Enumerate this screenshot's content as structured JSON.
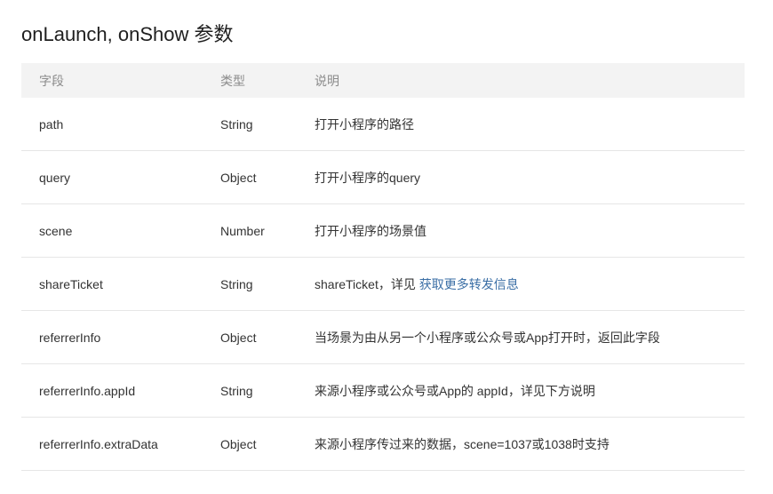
{
  "title": "onLaunch, onShow 参数",
  "table": {
    "headers": {
      "field": "字段",
      "type": "类型",
      "desc": "说明"
    },
    "rows": [
      {
        "field": "path",
        "type": "String",
        "desc": "打开小程序的路径",
        "desc_link": ""
      },
      {
        "field": "query",
        "type": "Object",
        "desc": "打开小程序的query",
        "desc_link": ""
      },
      {
        "field": "scene",
        "type": "Number",
        "desc": "打开小程序的场景值",
        "desc_link": ""
      },
      {
        "field": "shareTicket",
        "type": "String",
        "desc": "shareTicket，详见 ",
        "desc_link": "获取更多转发信息"
      },
      {
        "field": "referrerInfo",
        "type": "Object",
        "desc": "当场景为由从另一个小程序或公众号或App打开时，返回此字段",
        "desc_link": ""
      },
      {
        "field": "referrerInfo.appId",
        "type": "String",
        "desc": "来源小程序或公众号或App的 appId，详见下方说明",
        "desc_link": ""
      },
      {
        "field": "referrerInfo.extraData",
        "type": "Object",
        "desc": "来源小程序传过来的数据，scene=1037或1038时支持",
        "desc_link": ""
      }
    ]
  },
  "colors": {
    "header_bg": "#f3f3f3",
    "header_text": "#8b8b8b",
    "link": "#3a6ea5",
    "row_border": "#e6e6e6"
  }
}
